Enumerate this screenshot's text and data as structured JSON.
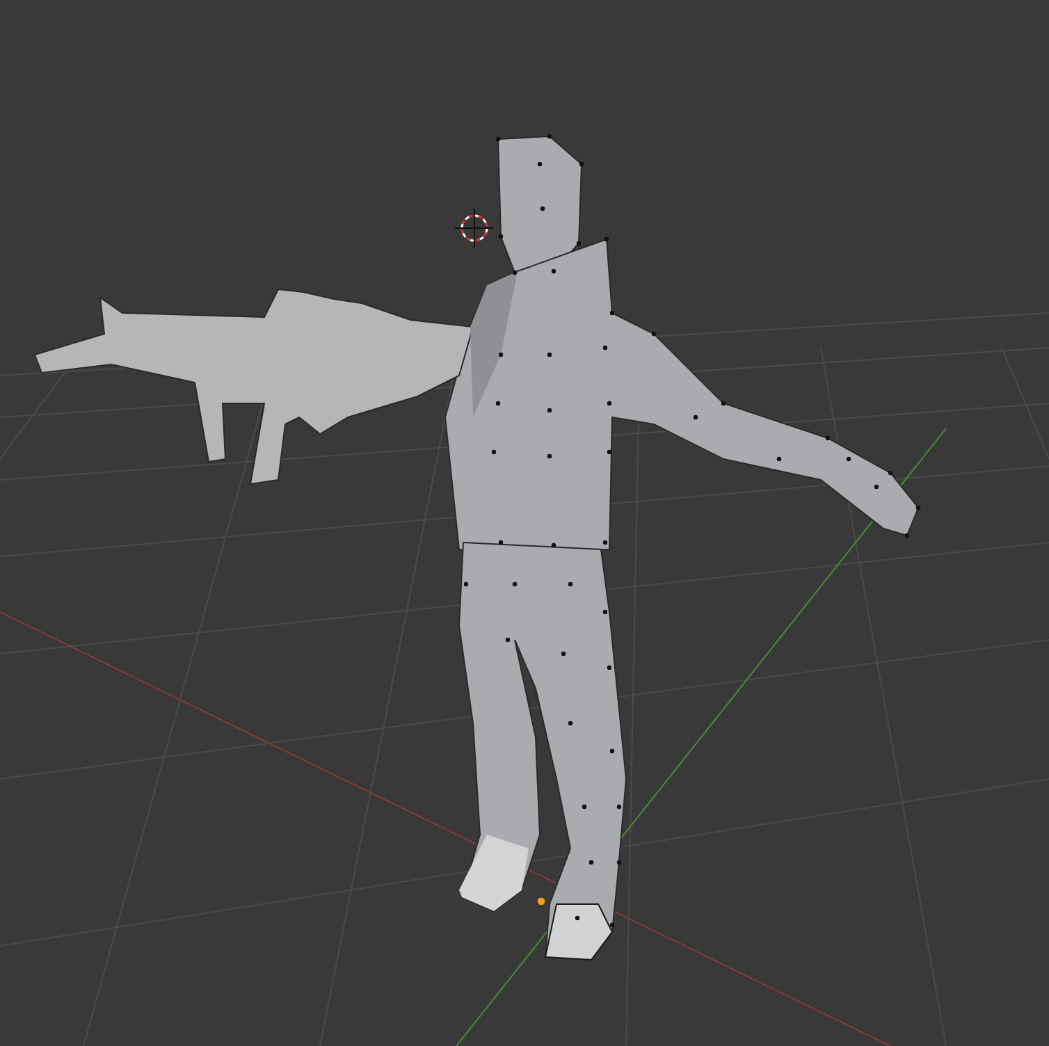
{
  "viewport": {
    "show_grid": true,
    "show_x_axis": true,
    "show_y_axis": true,
    "show_3d_cursor": true,
    "show_origin": true,
    "show_vertices": true
  }
}
